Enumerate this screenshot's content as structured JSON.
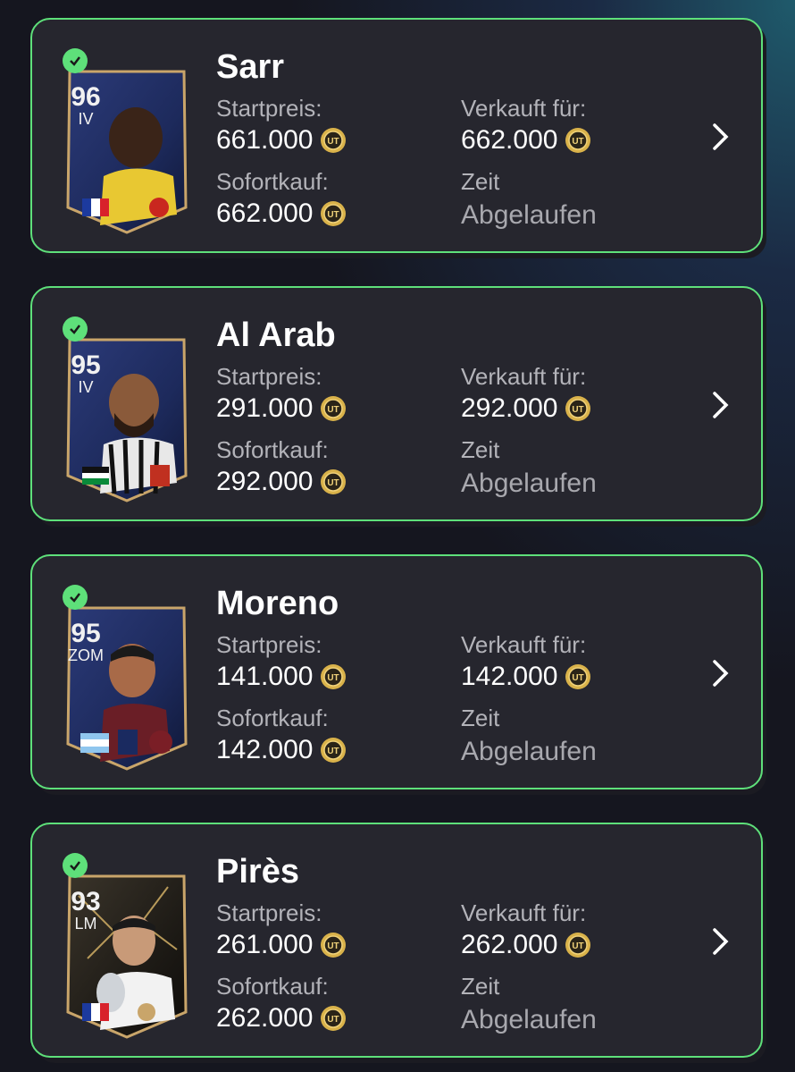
{
  "labels": {
    "start_price": "Startpreis:",
    "buy_now": "Sofortkauf:",
    "sold_for": "Verkauft für:",
    "time": "Zeit"
  },
  "listings": [
    {
      "name": "Sarr",
      "rating": "96",
      "position": "IV",
      "start_price": "661.000",
      "buy_now": "662.000",
      "sold_for": "662.000",
      "time": "Abgelaufen",
      "card_style": "tots"
    },
    {
      "name": "Al Arab",
      "rating": "95",
      "position": "IV",
      "start_price": "291.000",
      "buy_now": "292.000",
      "sold_for": "292.000",
      "time": "Abgelaufen",
      "card_style": "tots"
    },
    {
      "name": "Moreno",
      "rating": "95",
      "position": "ZOM",
      "start_price": "141.000",
      "buy_now": "142.000",
      "sold_for": "142.000",
      "time": "Abgelaufen",
      "card_style": "tots"
    },
    {
      "name": "Pirès",
      "rating": "93",
      "position": "LM",
      "start_price": "261.000",
      "buy_now": "262.000",
      "sold_for": "262.000",
      "time": "Abgelaufen",
      "card_style": "icon"
    }
  ],
  "colors": {
    "accent": "#5ee07a",
    "card_bg": "#26262e",
    "coin": "#d9b24a"
  },
  "icons": {
    "check": "check-icon",
    "coin": "coin-icon",
    "chevron": "chevron-right-icon"
  }
}
